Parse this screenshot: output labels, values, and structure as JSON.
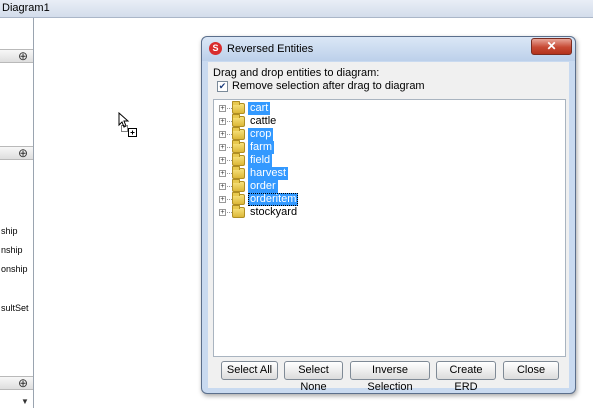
{
  "window": {
    "title": "Diagram1"
  },
  "left_panel": {
    "labels": [
      "ship",
      "nship",
      "onship",
      "sultSet"
    ]
  },
  "dialog": {
    "title": "Reversed Entities",
    "instruction": "Drag and drop entities to diagram:",
    "remove_checkbox": {
      "label": "Remove selection after drag to diagram",
      "checked": true
    },
    "entities": [
      {
        "name": "cart",
        "selected": true
      },
      {
        "name": "cattle",
        "selected": false
      },
      {
        "name": "crop",
        "selected": true
      },
      {
        "name": "farm",
        "selected": true
      },
      {
        "name": "field",
        "selected": true
      },
      {
        "name": "harvest",
        "selected": true
      },
      {
        "name": "order",
        "selected": true
      },
      {
        "name": "orderitem",
        "selected": true
      },
      {
        "name": "stockyard",
        "selected": false
      }
    ],
    "buttons": {
      "select_all": "Select All",
      "select_none": "Select None",
      "inverse_selection": "Inverse Selection",
      "create_erd": "Create ERD",
      "close": "Close"
    }
  },
  "colors": {
    "selection": "#3399ff",
    "dialog_frame": "#c9daf0",
    "close_button": "#c74a34"
  }
}
